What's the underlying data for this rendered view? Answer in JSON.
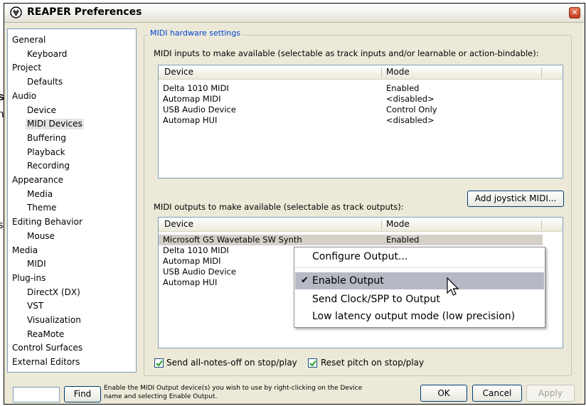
{
  "window": {
    "title": "REAPER Preferences",
    "close_glyph": "✕"
  },
  "background": {
    "fragment_s": "s",
    "fragment_n": "n",
    "fragment_s2": "s"
  },
  "tree": {
    "items": [
      {
        "label": "General",
        "level": 0
      },
      {
        "label": "Keyboard",
        "level": 1
      },
      {
        "label": "Project",
        "level": 0
      },
      {
        "label": "Defaults",
        "level": 1
      },
      {
        "label": "Audio",
        "level": 0
      },
      {
        "label": "Device",
        "level": 1
      },
      {
        "label": "MIDI Devices",
        "level": 1,
        "selected": true
      },
      {
        "label": "Buffering",
        "level": 1
      },
      {
        "label": "Playback",
        "level": 1
      },
      {
        "label": "Recording",
        "level": 1
      },
      {
        "label": "Appearance",
        "level": 0
      },
      {
        "label": "Media",
        "level": 1
      },
      {
        "label": "Theme",
        "level": 1
      },
      {
        "label": "Editing Behavior",
        "level": 0
      },
      {
        "label": "Mouse",
        "level": 1
      },
      {
        "label": "Media",
        "level": 0
      },
      {
        "label": "MIDI",
        "level": 1
      },
      {
        "label": "Plug-ins",
        "level": 0
      },
      {
        "label": "DirectX (DX)",
        "level": 1
      },
      {
        "label": "VST",
        "level": 1
      },
      {
        "label": "Visualization",
        "level": 1
      },
      {
        "label": "ReaMote",
        "level": 1
      },
      {
        "label": "Control Surfaces",
        "level": 0
      },
      {
        "label": "External Editors",
        "level": 0
      }
    ]
  },
  "midi": {
    "group_title": "MIDI hardware settings",
    "inputs_label": "MIDI inputs to make available (selectable as track inputs and/or learnable or action-bindable):",
    "outputs_label": "MIDI outputs to make available (selectable as track outputs):",
    "columns": {
      "device": "Device",
      "mode": "Mode"
    },
    "inputs": [
      {
        "device": "Delta 1010 MIDI",
        "mode": "Enabled"
      },
      {
        "device": "Automap MIDI",
        "mode": "<disabled>"
      },
      {
        "device": "USB Audio Device",
        "mode": "Control Only"
      },
      {
        "device": "Automap HUI",
        "mode": "<disabled>"
      }
    ],
    "outputs": [
      {
        "device": "Microsoft GS Wavetable SW Synth",
        "mode": "Enabled"
      },
      {
        "device": "Delta 1010 MIDI",
        "mode": ""
      },
      {
        "device": "Automap MIDI",
        "mode": ""
      },
      {
        "device": "USB Audio Device",
        "mode": ""
      },
      {
        "device": "Automap HUI",
        "mode": ""
      }
    ],
    "add_joystick_label": "Add joystick MIDI...",
    "send_all_notes_off_label": "Send all-notes-off on stop/play",
    "reset_pitch_label": "Reset pitch on stop/play"
  },
  "context_menu": {
    "items": [
      {
        "label": "Configure Output...",
        "checked": false
      },
      {
        "label": "Enable Output",
        "checked": true,
        "hover": true
      },
      {
        "label": "Send Clock/SPP to Output",
        "checked": false
      },
      {
        "label": "Low latency output mode (low precision)",
        "checked": false
      }
    ],
    "check_glyph": "✔"
  },
  "footer": {
    "find_label": "Find",
    "hint_line1": "Enable the MIDI Output device(s) you wish to use by right-clicking on the Device",
    "hint_line2": "name and selecting Enable Output.",
    "ok_label": "OK",
    "cancel_label": "Cancel",
    "apply_label": "Apply"
  },
  "colors": {
    "group_title": "#0046d5",
    "menu_highlight": "#b6b9c4",
    "window_bg": "#ece9d8"
  }
}
